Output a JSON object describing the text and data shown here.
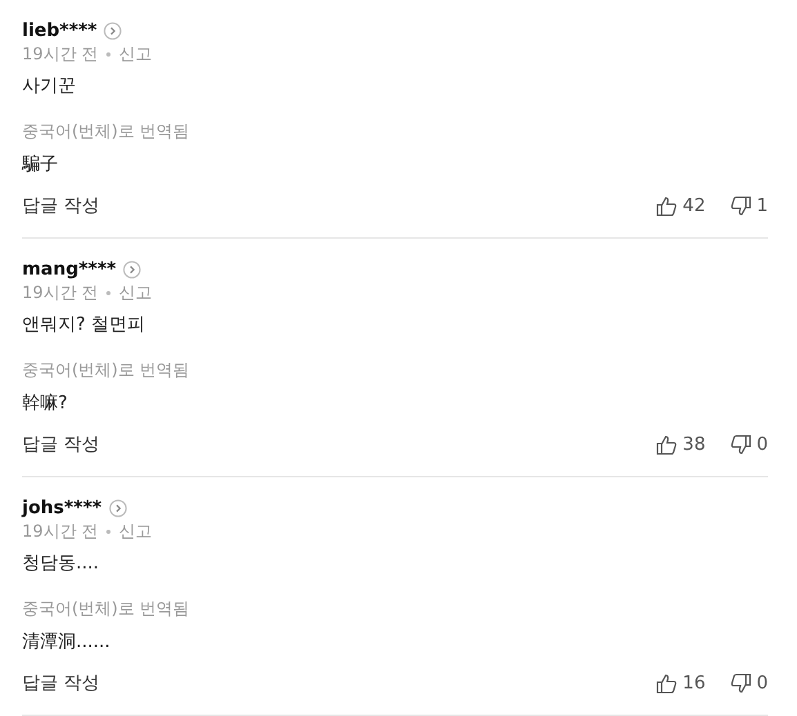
{
  "comments": [
    {
      "user": "lieb****",
      "time": "19시간 전",
      "report": "신고",
      "text": "사기꾼",
      "translation_label": "중국어(번체)로 번역됨",
      "translation": "騙子",
      "reply": "답글 작성",
      "likes": "42",
      "dislikes": "1"
    },
    {
      "user": "mang****",
      "time": "19시간 전",
      "report": "신고",
      "text": "앤뭐지? 철면피",
      "translation_label": "중국어(번체)로 번역됨",
      "translation": "幹嘛?",
      "reply": "답글 작성",
      "likes": "38",
      "dislikes": "0"
    },
    {
      "user": "johs****",
      "time": "19시간 전",
      "report": "신고",
      "text": "청담동....",
      "translation_label": "중국어(번체)로 번역됨",
      "translation": "清潭洞......",
      "reply": "답글 작성",
      "likes": "16",
      "dislikes": "0"
    }
  ]
}
